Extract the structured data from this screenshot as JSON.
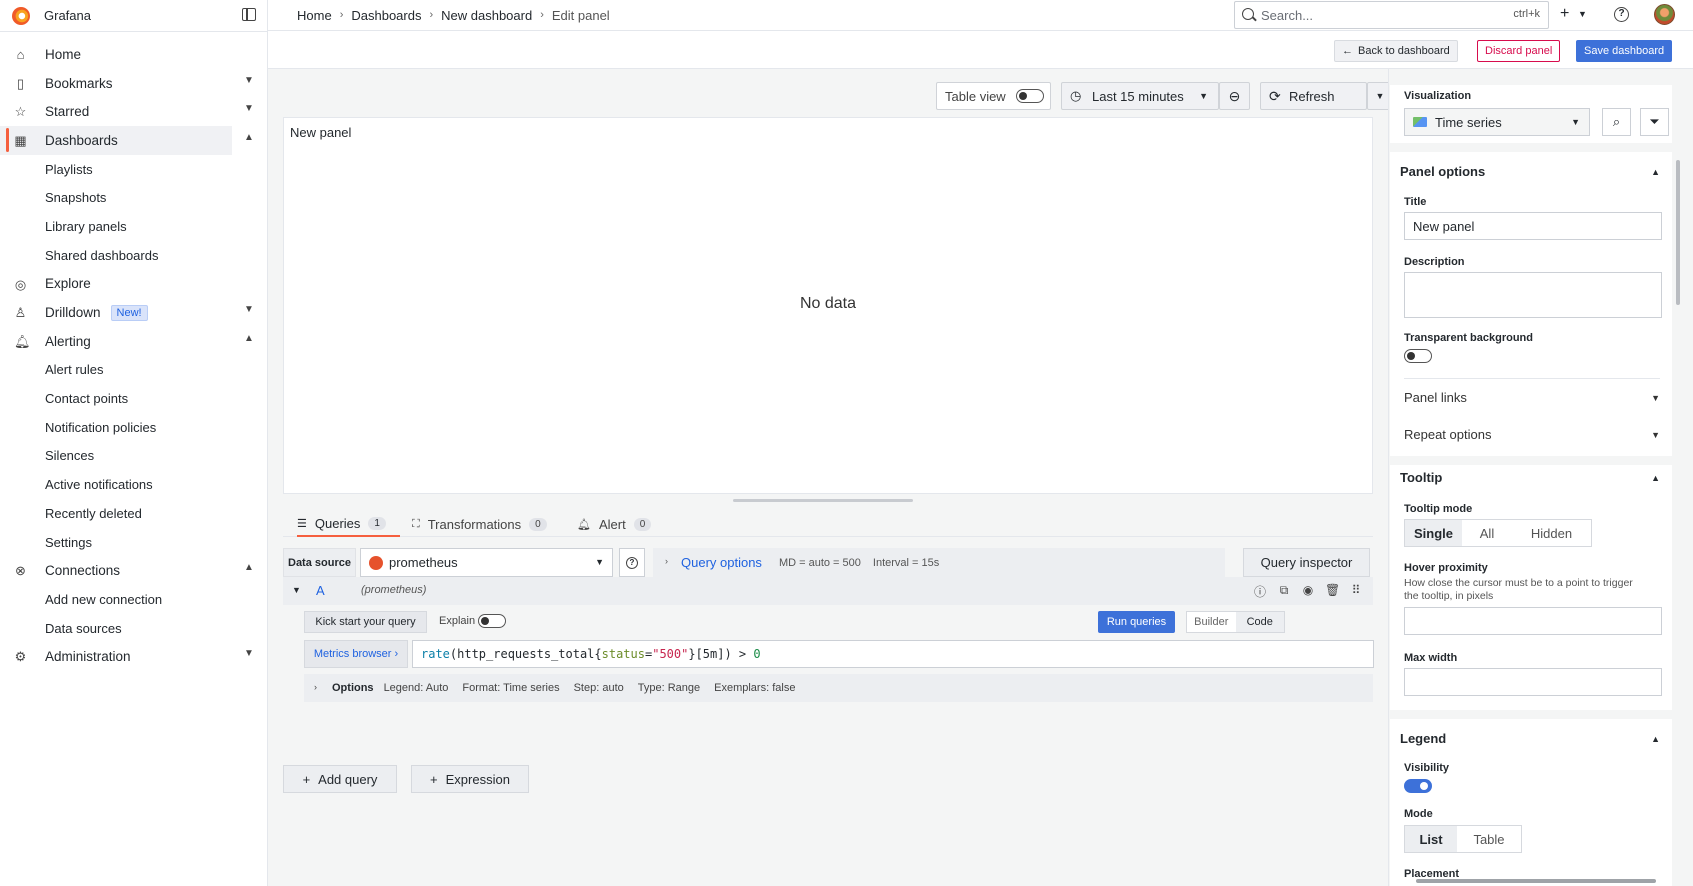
{
  "app": {
    "name": "Grafana"
  },
  "sidebar": {
    "items": [
      {
        "label": "Home",
        "icon": "home-icon"
      },
      {
        "label": "Bookmarks",
        "icon": "bookmark-icon",
        "expandable": true
      },
      {
        "label": "Starred",
        "icon": "star-icon",
        "expandable": true
      },
      {
        "label": "Dashboards",
        "icon": "apps-icon",
        "expandable": true,
        "active": true
      },
      {
        "label": "Playlists",
        "sub": true
      },
      {
        "label": "Snapshots",
        "sub": true
      },
      {
        "label": "Library panels",
        "sub": true
      },
      {
        "label": "Shared dashboards",
        "sub": true
      },
      {
        "label": "Explore",
        "icon": "compass-icon"
      },
      {
        "label": "Drilldown",
        "icon": "drilldown-icon",
        "expandable": true,
        "badge": "New!"
      },
      {
        "label": "Alerting",
        "icon": "bell-icon",
        "expandable": true
      },
      {
        "label": "Alert rules",
        "sub": true
      },
      {
        "label": "Contact points",
        "sub": true
      },
      {
        "label": "Notification policies",
        "sub": true
      },
      {
        "label": "Silences",
        "sub": true
      },
      {
        "label": "Active notifications",
        "sub": true
      },
      {
        "label": "Recently deleted",
        "sub": true
      },
      {
        "label": "Settings",
        "sub": true
      },
      {
        "label": "Connections",
        "icon": "connections-icon",
        "expandable": true
      },
      {
        "label": "Add new connection",
        "sub": true
      },
      {
        "label": "Data sources",
        "sub": true
      },
      {
        "label": "Administration",
        "icon": "cog-icon",
        "expandable": true
      }
    ]
  },
  "topbar": {
    "breadcrumbs": [
      "Home",
      "Dashboards",
      "New dashboard",
      "Edit panel"
    ],
    "search_placeholder": "Search...",
    "search_shortcut": "ctrl+k"
  },
  "actionbar": {
    "back_label": "Back to dashboard",
    "discard_label": "Discard panel",
    "save_label": "Save dashboard"
  },
  "panel_toolbar": {
    "table_view_label": "Table view",
    "time_range": "Last 15 minutes",
    "refresh_label": "Refresh"
  },
  "panel": {
    "title": "New panel",
    "empty_message": "No data"
  },
  "query_tabs": [
    {
      "label": "Queries",
      "count": "1",
      "icon": "database-icon"
    },
    {
      "label": "Transformations",
      "count": "0",
      "icon": "transform-icon"
    },
    {
      "label": "Alert",
      "count": "0",
      "icon": "bell-icon"
    }
  ],
  "query_toolbar": {
    "datasource_label": "Data source",
    "datasource_value": "prometheus",
    "query_options_label": "Query options",
    "md_text": "MD = auto = 500",
    "interval_text": "Interval = 15s",
    "inspector_label": "Query inspector"
  },
  "query_row": {
    "ref_id": "A",
    "datasource": "(prometheus)",
    "kick_start_label": "Kick start your query",
    "explain_label": "Explain",
    "run_label": "Run queries",
    "mode_builder": "Builder",
    "mode_code": "Code",
    "metrics_browser_label": "Metrics browser ›",
    "query_parts": {
      "fn": "rate",
      "open": "(http_requests_total{",
      "label": "status",
      "eq": "=",
      "value": "\"500\"",
      "close": "}[5m]) > ",
      "threshold": "0"
    },
    "options_label": "Options",
    "options_meta": [
      "Legend: Auto",
      "Format: Time series",
      "Step: auto",
      "Type: Range",
      "Exemplars: false"
    ]
  },
  "add_buttons": {
    "add_query": "Add query",
    "expression": "Expression"
  },
  "options_pane": {
    "visualization_label": "Visualization",
    "visualization_value": "Time series",
    "panel_options": {
      "header": "Panel options",
      "title_label": "Title",
      "title_value": "New panel",
      "description_label": "Description",
      "transparent_label": "Transparent background",
      "panel_links": "Panel links",
      "repeat_options": "Repeat options"
    },
    "tooltip": {
      "header": "Tooltip",
      "mode_label": "Tooltip mode",
      "modes": [
        "Single",
        "All",
        "Hidden"
      ],
      "hover_label": "Hover proximity",
      "hover_desc": "How close the cursor must be to a point to trigger the tooltip, in pixels",
      "max_width_label": "Max width"
    },
    "legend": {
      "header": "Legend",
      "visibility_label": "Visibility",
      "mode_label": "Mode",
      "modes": [
        "List",
        "Table"
      ],
      "placement_label": "Placement"
    }
  },
  "colors": {
    "accent_orange": "#f55f3e",
    "primary_blue": "#3d71d9",
    "link_blue": "#1f62e0",
    "destructive": "#d70c4d"
  }
}
